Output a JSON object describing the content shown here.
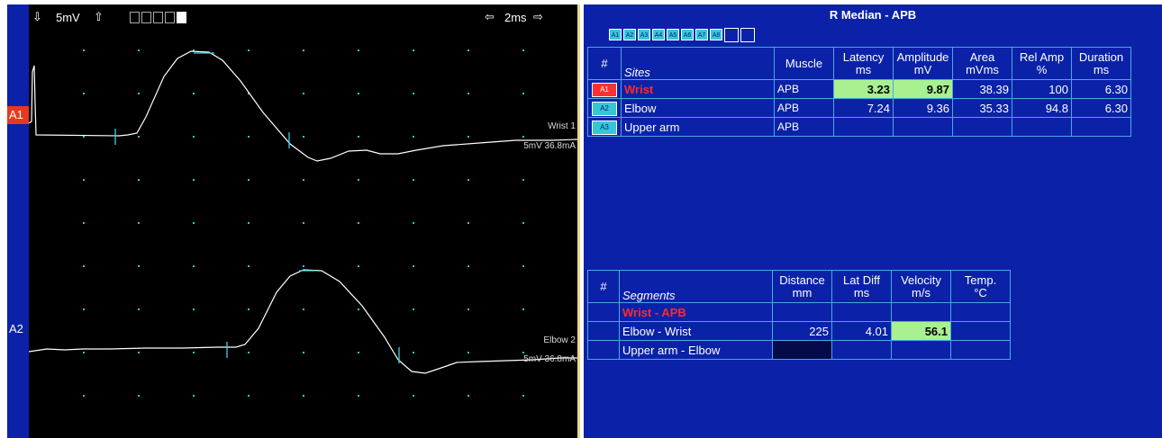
{
  "channels": {
    "a1": "A1",
    "a2": "A2"
  },
  "waveform": {
    "sensitivity": "5mV",
    "sweep": "2ms",
    "trace1_label": "Wrist 1",
    "trace1_settings": "5mV 36.8mA",
    "trace2_label": "Elbow 2",
    "trace2_settings": "5mV 36.8mA",
    "trace_color": "#ffffff",
    "marker_color": "#3ad0e6",
    "grid_dot_color": "#2ec8c8"
  },
  "report": {
    "title": "R Median - APB",
    "site_buttons": [
      "A1",
      "A2",
      "A3",
      "A4",
      "A5",
      "A6",
      "A7",
      "A8"
    ],
    "sites_headers": {
      "num": "#",
      "sites": "Sites",
      "muscle": "Muscle",
      "latency": [
        "Latency",
        "ms"
      ],
      "amplitude": [
        "Amplitude",
        "mV"
      ],
      "area": [
        "Area",
        "mVms"
      ],
      "rel_amp": [
        "Rel Amp",
        "%"
      ],
      "duration": [
        "Duration",
        "ms"
      ]
    },
    "sites": [
      {
        "chip": "A1",
        "name": "Wrist",
        "muscle": "APB",
        "latency": "3.23",
        "amplitude": "9.87",
        "area": "38.39",
        "rel_amp": "100",
        "duration": "6.30"
      },
      {
        "chip": "A2",
        "name": "Elbow",
        "muscle": "APB",
        "latency": "7.24",
        "amplitude": "9.36",
        "area": "35.33",
        "rel_amp": "94.8",
        "duration": "6.30"
      },
      {
        "chip": "A3",
        "name": "Upper arm",
        "muscle": "APB",
        "latency": "",
        "amplitude": "",
        "area": "",
        "rel_amp": "",
        "duration": ""
      }
    ],
    "segments_headers": {
      "num": "#",
      "segments": "Segments",
      "distance": [
        "Distance",
        "mm"
      ],
      "lat_diff": [
        "Lat Diff",
        "ms"
      ],
      "velocity": [
        "Velocity",
        "m/s"
      ],
      "temp": [
        "Temp.",
        "°C"
      ]
    },
    "segments": [
      {
        "name": "Wrist - APB",
        "distance": "",
        "lat_diff": "",
        "velocity": "",
        "temp": ""
      },
      {
        "name": "Elbow - Wrist",
        "distance": "225",
        "lat_diff": "4.01",
        "velocity": "56.1",
        "temp": ""
      },
      {
        "name": "Upper arm - Elbow",
        "distance": "",
        "lat_diff": "",
        "velocity": "",
        "temp": ""
      }
    ],
    "highlight_color": "#a8f090",
    "panel_color": "#0b22a8"
  }
}
